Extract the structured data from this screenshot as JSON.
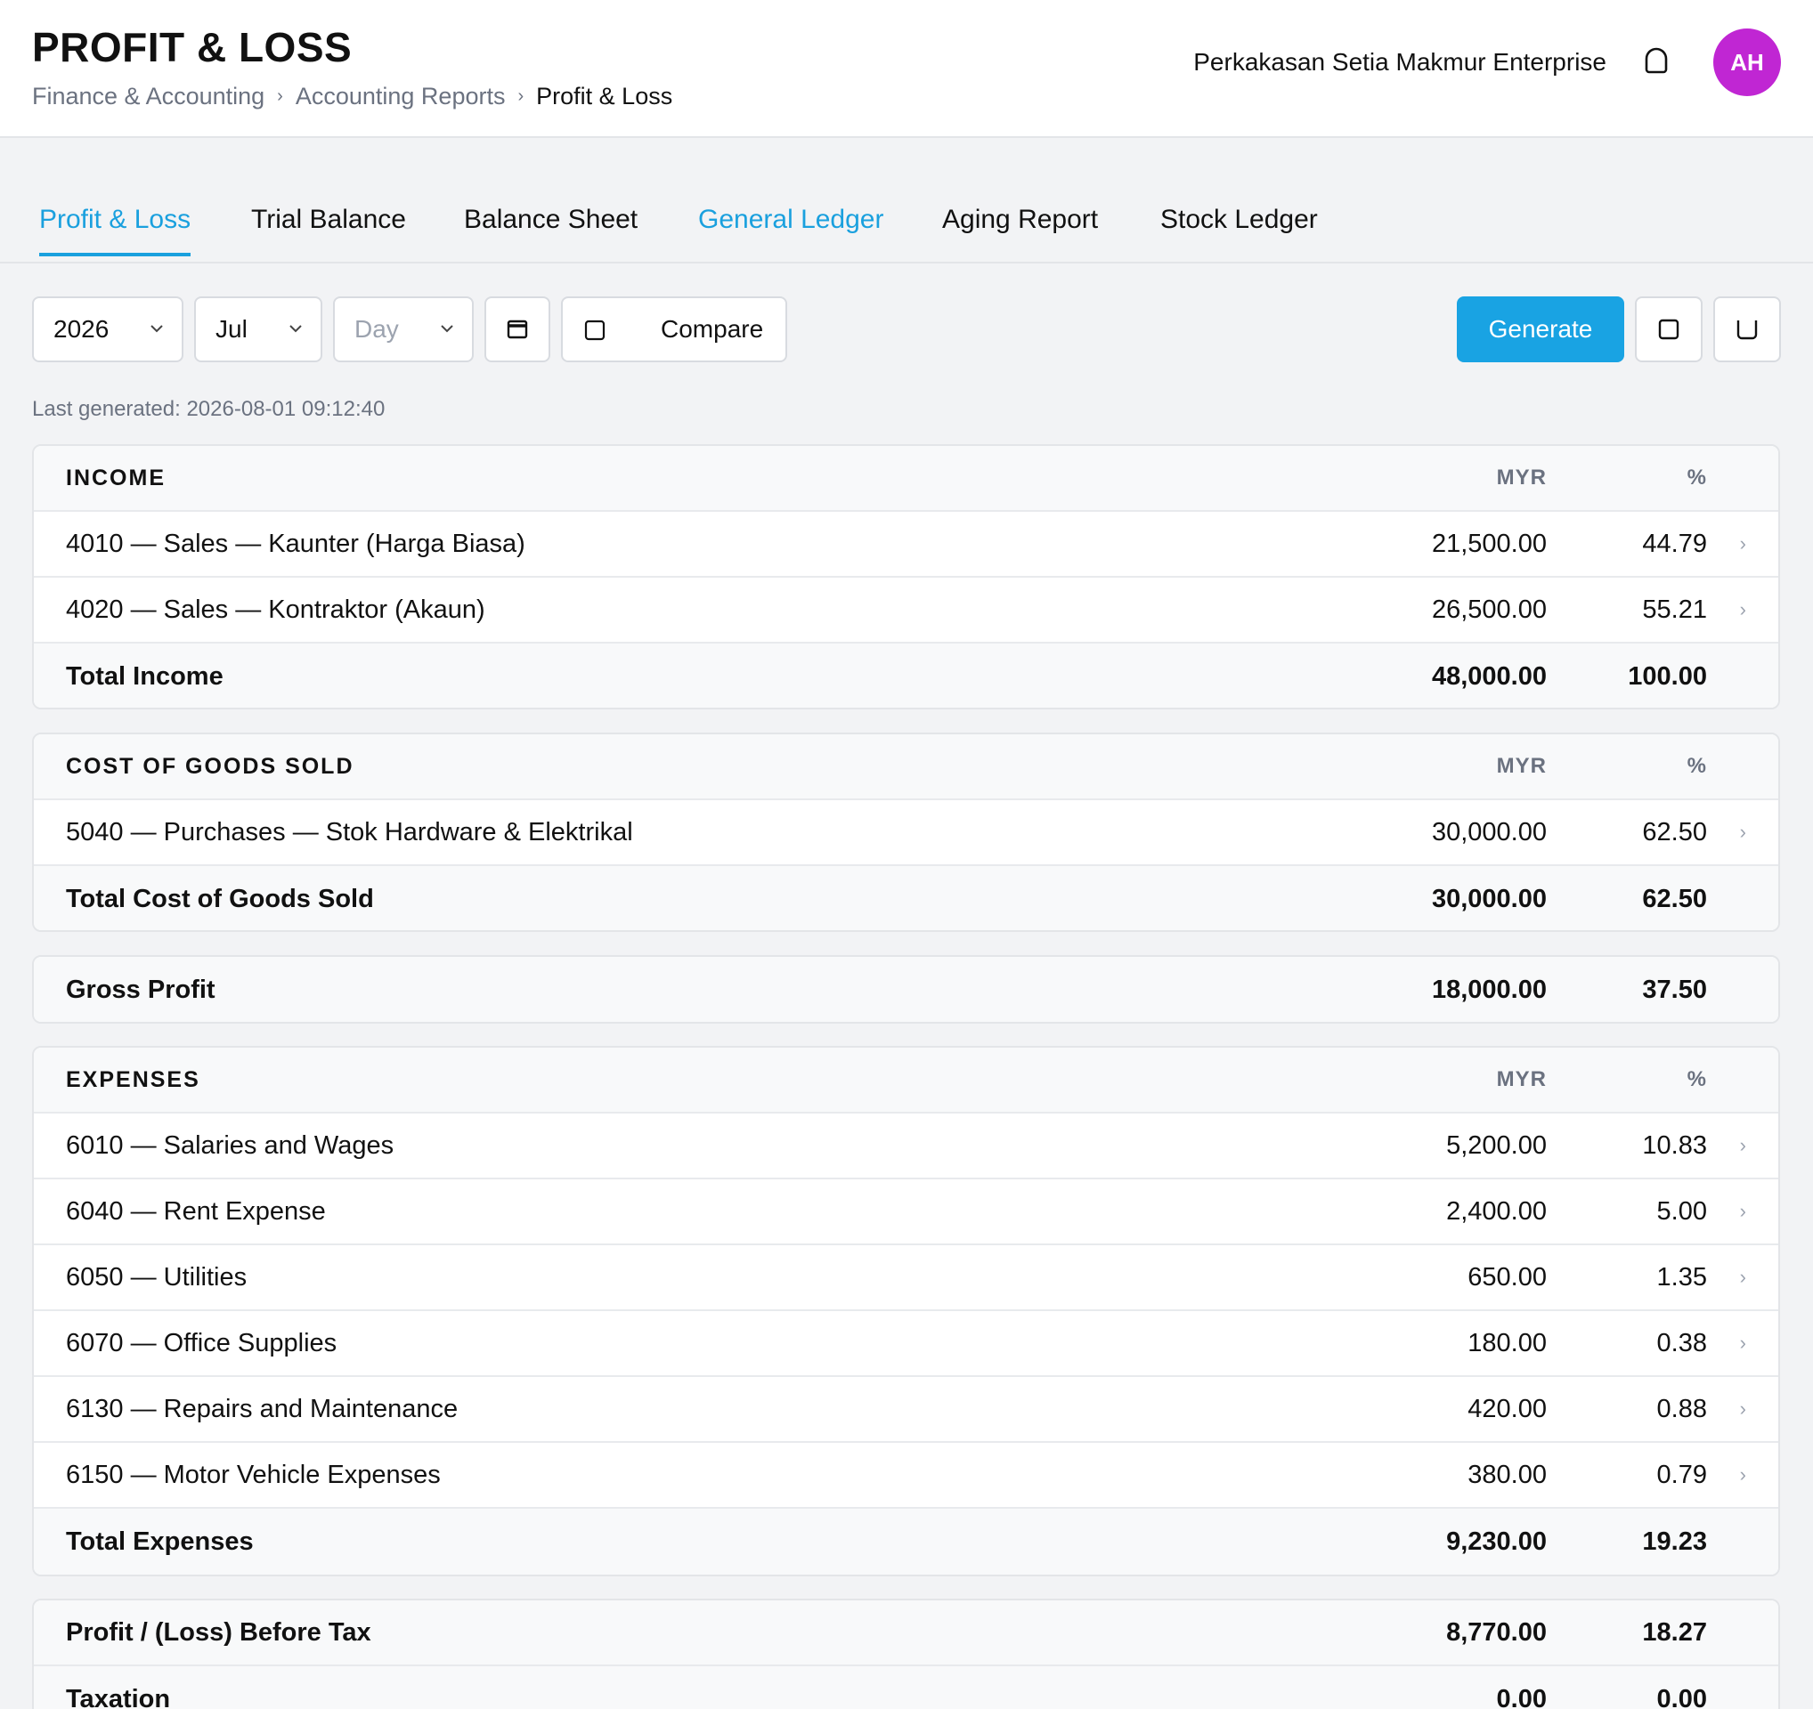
{
  "header": {
    "title": "PROFIT & LOSS",
    "breadcrumb": [
      "Finance & Accounting",
      "Accounting Reports",
      "Profit & Loss"
    ],
    "company": "Perkakasan Setia Makmur Enterprise",
    "avatar_initials": "AH",
    "avatar_color": "#c026d3"
  },
  "tabs": [
    {
      "label": "Profit & Loss",
      "state": "active"
    },
    {
      "label": "Trial Balance",
      "state": "normal"
    },
    {
      "label": "Balance Sheet",
      "state": "normal"
    },
    {
      "label": "General Ledger",
      "state": "link"
    },
    {
      "label": "Aging Report",
      "state": "normal"
    },
    {
      "label": "Stock Ledger",
      "state": "normal"
    }
  ],
  "toolbar": {
    "year": "2026",
    "month": "Jul",
    "day_placeholder": "Day",
    "compare_label": "Compare",
    "generate_label": "Generate",
    "accent_color": "#19a3e3"
  },
  "last_generated": "Last generated: 2026-08-01 09:12:40",
  "income": {
    "heading": "INCOME",
    "col_amount": "MYR",
    "col_pct": "%",
    "rows": [
      {
        "label": "4010 — Sales — Kaunter (Harga Biasa)",
        "amount": "21,500.00",
        "pct": "44.79"
      },
      {
        "label": "4020 — Sales — Kontraktor (Akaun)",
        "amount": "26,500.00",
        "pct": "55.21"
      }
    ],
    "total": {
      "label": "Total Income",
      "amount": "48,000.00",
      "pct": "100.00"
    }
  },
  "cogs": {
    "heading": "COST OF GOODS SOLD",
    "col_amount": "MYR",
    "col_pct": "%",
    "rows": [
      {
        "label": "5040 — Purchases — Stok Hardware & Elektrikal",
        "amount": "30,000.00",
        "pct": "62.50"
      }
    ],
    "total": {
      "label": "Total Cost of Goods Sold",
      "amount": "30,000.00",
      "pct": "62.50"
    }
  },
  "gross_profit": {
    "label": "Gross Profit",
    "amount": "18,000.00",
    "pct": "37.50"
  },
  "expenses": {
    "heading": "EXPENSES",
    "col_amount": "MYR",
    "col_pct": "%",
    "rows": [
      {
        "label": "6010 — Salaries and Wages",
        "amount": "5,200.00",
        "pct": "10.83"
      },
      {
        "label": "6040 — Rent Expense",
        "amount": "2,400.00",
        "pct": "5.00"
      },
      {
        "label": "6050 — Utilities",
        "amount": "650.00",
        "pct": "1.35"
      },
      {
        "label": "6070 — Office Supplies",
        "amount": "180.00",
        "pct": "0.38"
      },
      {
        "label": "6130 — Repairs and Maintenance",
        "amount": "420.00",
        "pct": "0.88"
      },
      {
        "label": "6150 — Motor Vehicle Expenses",
        "amount": "380.00",
        "pct": "0.79"
      }
    ],
    "total": {
      "label": "Total Expenses",
      "amount": "9,230.00",
      "pct": "19.23"
    }
  },
  "profit_before_tax": {
    "label": "Profit / (Loss) Before Tax",
    "amount": "8,770.00",
    "pct": "18.27"
  },
  "taxation": {
    "label": "Taxation",
    "amount": "0.00",
    "pct": "0.00"
  }
}
